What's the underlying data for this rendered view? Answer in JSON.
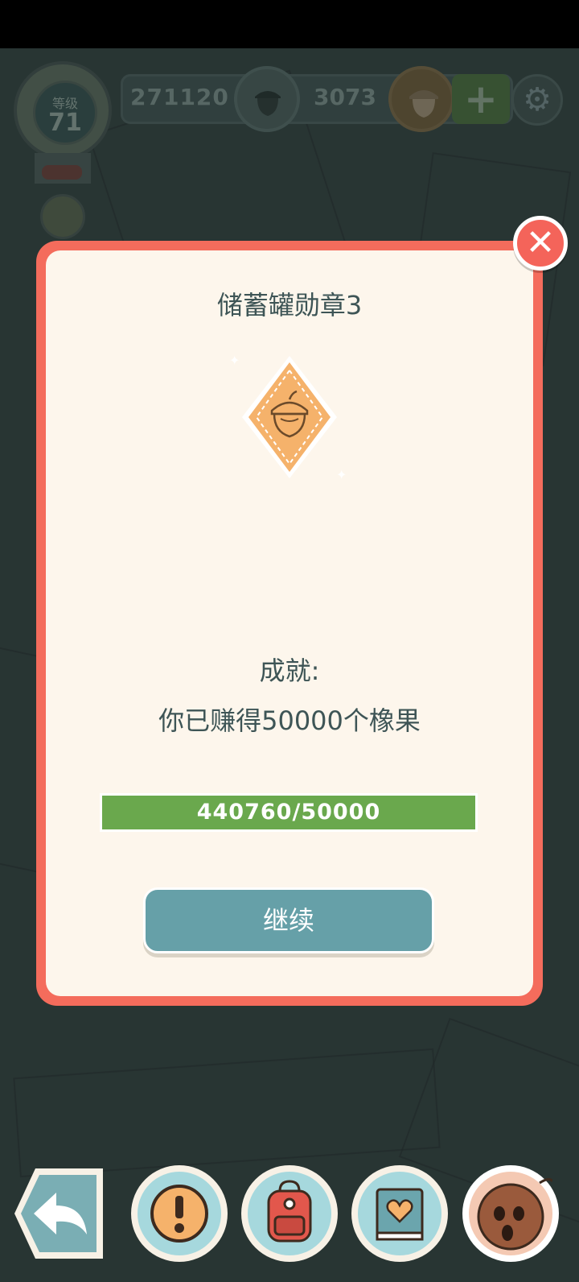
{
  "header": {
    "level_label": "等级",
    "level_value": "71",
    "coins": "271120",
    "gems": "3073",
    "plus_label": "+",
    "settings_glyph": "⚙"
  },
  "dialog": {
    "title": "储蓄罐勋章3",
    "close_glyph": "✕",
    "badge_icon": "acorn-diamond-badge",
    "achievement_label": "成就:",
    "achievement_desc": "你已赚得50000个橡果",
    "progress_text": "440760/50000",
    "progress_fraction": 1.0,
    "continue_label": "继续"
  },
  "bottom_nav": {
    "items": [
      "back-arrow-icon",
      "alert-icon",
      "backpack-icon",
      "heart-book-icon",
      "coconut-character-icon"
    ]
  },
  "colors": {
    "dialog_border": "#f46c5c",
    "dialog_bg": "#fdf6ec",
    "progress": "#6aa84d",
    "button": "#66a0a8",
    "badge": "#f5b26b"
  }
}
